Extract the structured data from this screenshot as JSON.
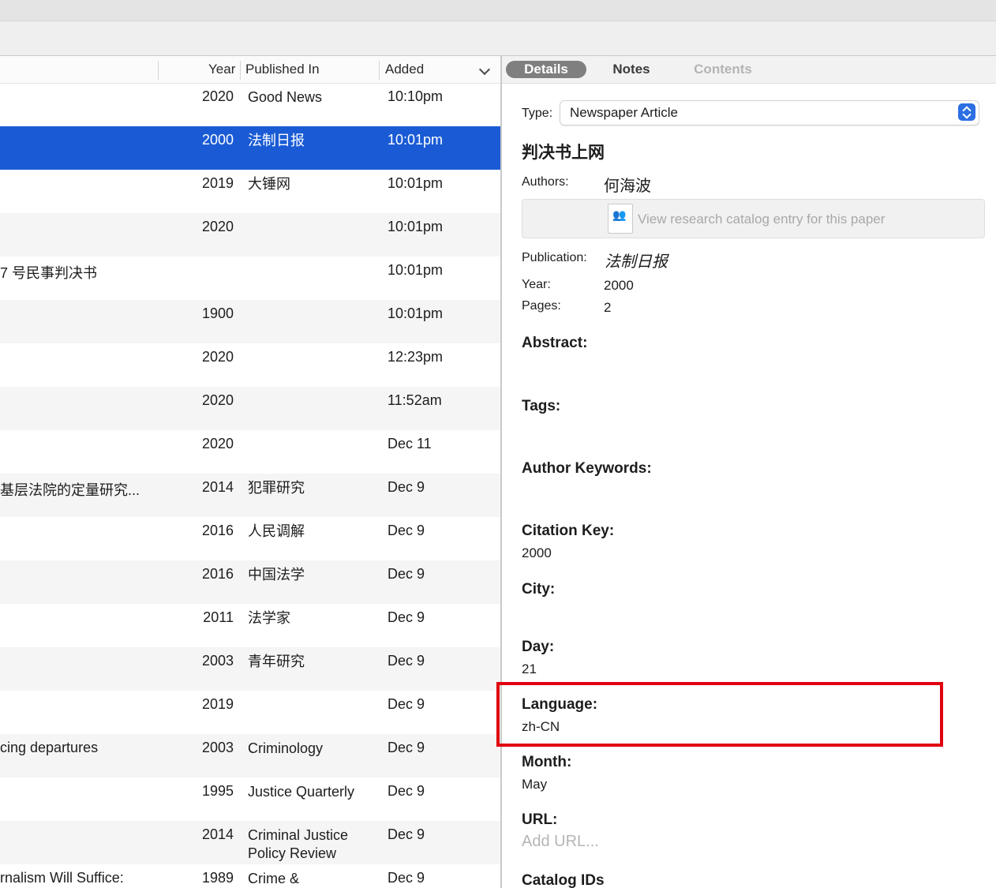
{
  "list": {
    "columns": {
      "year": "Year",
      "published_in": "Published In",
      "added": "Added"
    },
    "rows": [
      {
        "title": "",
        "year": "2020",
        "published": "Good News",
        "added": "10:10pm"
      },
      {
        "title": "",
        "year": "2000",
        "published": "法制日报",
        "added": "10:01pm",
        "selected": true
      },
      {
        "title": "",
        "year": "2019",
        "published": "大锤网",
        "added": "10:01pm"
      },
      {
        "title": "",
        "year": "2020",
        "published": "",
        "added": "10:01pm"
      },
      {
        "title": "7 号民事判决书",
        "year": "",
        "published": "",
        "added": "10:01pm"
      },
      {
        "title": "",
        "year": "1900",
        "published": "",
        "added": "10:01pm"
      },
      {
        "title": "",
        "year": "2020",
        "published": "",
        "added": "12:23pm"
      },
      {
        "title": "",
        "year": "2020",
        "published": "",
        "added": "11:52am"
      },
      {
        "title": "",
        "year": "2020",
        "published": "",
        "added": "Dec 11"
      },
      {
        "title": "基层法院的定量研究...",
        "year": "2014",
        "published": "犯罪研究",
        "added": "Dec 9"
      },
      {
        "title": "",
        "year": "2016",
        "published": "人民调解",
        "added": "Dec 9"
      },
      {
        "title": "",
        "year": "2016",
        "published": "中国法学",
        "added": "Dec 9"
      },
      {
        "title": "",
        "year": "2011",
        "published": "法学家",
        "added": "Dec 9"
      },
      {
        "title": "",
        "year": "2003",
        "published": "青年研究",
        "added": "Dec 9"
      },
      {
        "title": "",
        "year": "2019",
        "published": "",
        "added": "Dec 9"
      },
      {
        "title": "cing departures",
        "year": "2003",
        "published": "Criminology",
        "added": "Dec 9"
      },
      {
        "title": "",
        "year": "1995",
        "published": "Justice Quarterly",
        "added": "Dec 9"
      },
      {
        "title": "",
        "year": "2014",
        "published": "Criminal Justice\nPolicy Review",
        "added": "Dec 9"
      },
      {
        "title": "rnalism Will Suffice:",
        "year": "1989",
        "published": "Crime &",
        "added": "Dec 9"
      }
    ]
  },
  "detail": {
    "tabs": {
      "details": "Details",
      "notes": "Notes",
      "contents": "Contents"
    },
    "type_label": "Type:",
    "type_value": "Newspaper Article",
    "title": "判决书上网",
    "authors_label": "Authors:",
    "authors_value": "何海波",
    "catalog_button": "View research catalog entry for this paper",
    "publication_label": "Publication:",
    "publication_value": "法制日报",
    "year_label": "Year:",
    "year_value": "2000",
    "pages_label": "Pages:",
    "pages_value": "2",
    "abstract_label": "Abstract:",
    "tags_label": "Tags:",
    "author_keywords_label": "Author Keywords:",
    "citation_key_label": "Citation Key:",
    "citation_key_value": "2000",
    "city_label": "City:",
    "day_label": "Day:",
    "day_value": "21",
    "language_label": "Language:",
    "language_value": "zh-CN",
    "month_label": "Month:",
    "month_value": "May",
    "url_label": "URL:",
    "url_placeholder": "Add URL...",
    "catalog_ids_label": "Catalog IDs"
  },
  "colors": {
    "selection": "#1a5bd5",
    "highlight_box": "#e0000f",
    "accent": "#2c6fe3"
  }
}
